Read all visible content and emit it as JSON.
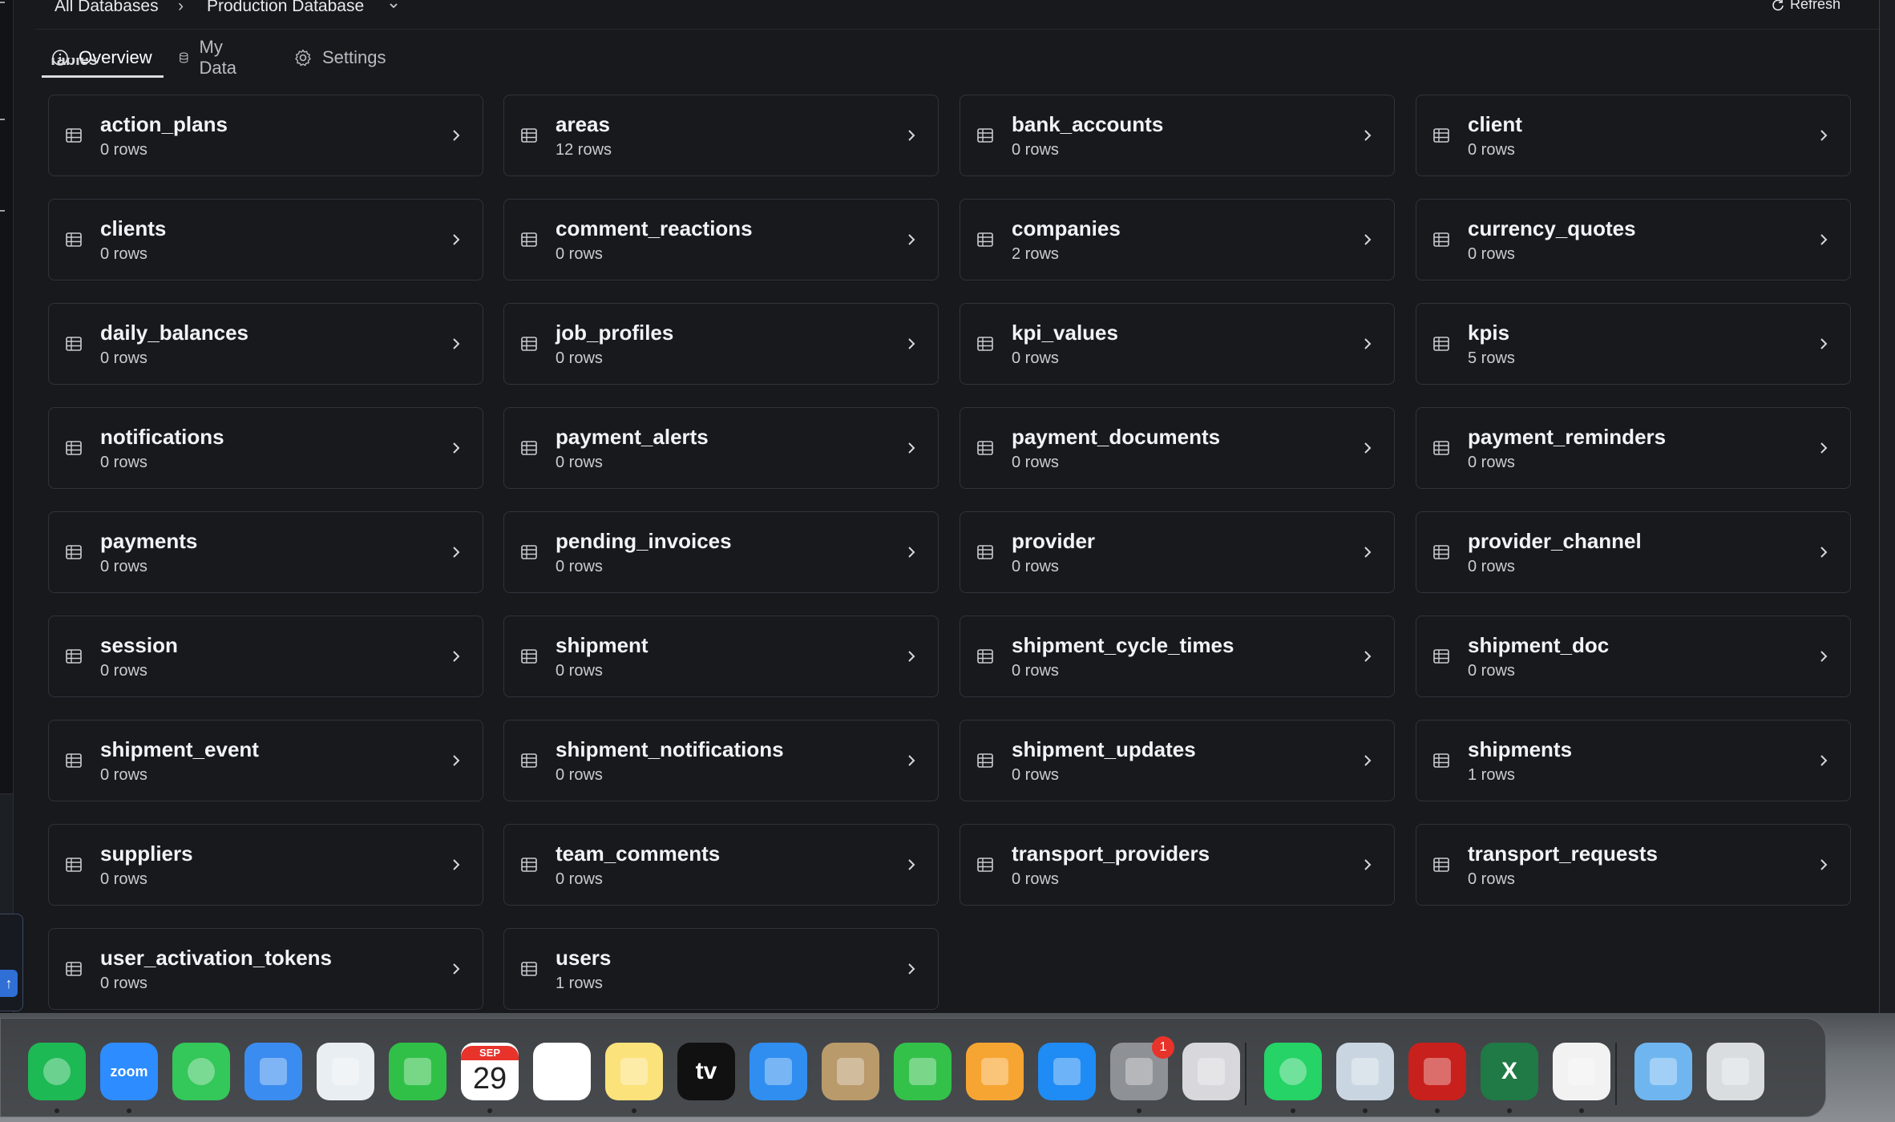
{
  "breadcrumb": {
    "root": "All Databases",
    "separator": "›",
    "current": "Production Database"
  },
  "header": {
    "refresh_label": "Refresh"
  },
  "tabs": [
    {
      "label": "Overview",
      "icon": "info-icon",
      "active": true
    },
    {
      "label": "My Data",
      "icon": "database-icon",
      "active": false
    },
    {
      "label": "Settings",
      "icon": "gear-icon",
      "active": false
    }
  ],
  "section": {
    "heading": "Tables"
  },
  "tables": [
    {
      "name": "action_plans",
      "rows": "0 rows"
    },
    {
      "name": "areas",
      "rows": "12 rows"
    },
    {
      "name": "bank_accounts",
      "rows": "0 rows"
    },
    {
      "name": "client",
      "rows": "0 rows"
    },
    {
      "name": "clients",
      "rows": "0 rows"
    },
    {
      "name": "comment_reactions",
      "rows": "0 rows"
    },
    {
      "name": "companies",
      "rows": "2 rows"
    },
    {
      "name": "currency_quotes",
      "rows": "0 rows"
    },
    {
      "name": "daily_balances",
      "rows": "0 rows"
    },
    {
      "name": "job_profiles",
      "rows": "0 rows"
    },
    {
      "name": "kpi_values",
      "rows": "0 rows"
    },
    {
      "name": "kpis",
      "rows": "5 rows"
    },
    {
      "name": "notifications",
      "rows": "0 rows"
    },
    {
      "name": "payment_alerts",
      "rows": "0 rows"
    },
    {
      "name": "payment_documents",
      "rows": "0 rows"
    },
    {
      "name": "payment_reminders",
      "rows": "0 rows"
    },
    {
      "name": "payments",
      "rows": "0 rows"
    },
    {
      "name": "pending_invoices",
      "rows": "0 rows"
    },
    {
      "name": "provider",
      "rows": "0 rows"
    },
    {
      "name": "provider_channel",
      "rows": "0 rows"
    },
    {
      "name": "session",
      "rows": "0 rows"
    },
    {
      "name": "shipment",
      "rows": "0 rows"
    },
    {
      "name": "shipment_cycle_times",
      "rows": "0 rows"
    },
    {
      "name": "shipment_doc",
      "rows": "0 rows"
    },
    {
      "name": "shipment_event",
      "rows": "0 rows"
    },
    {
      "name": "shipment_notifications",
      "rows": "0 rows"
    },
    {
      "name": "shipment_updates",
      "rows": "0 rows"
    },
    {
      "name": "shipments",
      "rows": "1 rows"
    },
    {
      "name": "suppliers",
      "rows": "0 rows"
    },
    {
      "name": "team_comments",
      "rows": "0 rows"
    },
    {
      "name": "transport_providers",
      "rows": "0 rows"
    },
    {
      "name": "transport_requests",
      "rows": "0 rows"
    },
    {
      "name": "user_activation_tokens",
      "rows": "0 rows"
    },
    {
      "name": "users",
      "rows": "1 rows"
    }
  ],
  "dock": {
    "apps": [
      {
        "name": "spotify",
        "label": "",
        "bg": "#1db954",
        "running": true
      },
      {
        "name": "zoom",
        "label": "zoom",
        "bg": "#2d8cff",
        "running": true
      },
      {
        "name": "messages",
        "label": "",
        "bg": "#34c759",
        "running": false
      },
      {
        "name": "mail",
        "label": "",
        "bg": "#3b8cf0",
        "running": false
      },
      {
        "name": "maps",
        "label": "",
        "bg": "#e8eef2",
        "running": false
      },
      {
        "name": "facetime",
        "label": "",
        "bg": "#30c048",
        "running": false
      },
      {
        "name": "calendar",
        "label": "29",
        "month": "SEP",
        "bg": "#ffffff",
        "running": true
      },
      {
        "name": "reminders",
        "label": "",
        "bg": "#ffffff",
        "running": false
      },
      {
        "name": "notes",
        "label": "",
        "bg": "#fbe27a",
        "running": true
      },
      {
        "name": "apple-tv",
        "label": "tv",
        "bg": "#111111",
        "running": false
      },
      {
        "name": "keynote",
        "label": "",
        "bg": "#2f8ef0",
        "running": false
      },
      {
        "name": "contacts",
        "label": "",
        "bg": "#b99a6b",
        "running": false
      },
      {
        "name": "numbers",
        "label": "",
        "bg": "#33c14a",
        "running": false
      },
      {
        "name": "pages",
        "label": "",
        "bg": "#f7a532",
        "running": false
      },
      {
        "name": "app-store",
        "label": "",
        "bg": "#1f8bf4",
        "running": false
      },
      {
        "name": "system-settings",
        "label": "",
        "bg": "#8e9196",
        "badge": "1",
        "running": true
      },
      {
        "name": "iphone-mirroring",
        "label": "",
        "bg": "#d8d8dc",
        "running": false
      },
      {
        "name": "whatsapp",
        "label": "",
        "bg": "#25d366",
        "running": true
      },
      {
        "name": "preview",
        "label": "",
        "bg": "#c9d6e2",
        "running": true
      },
      {
        "name": "acrobat",
        "label": "",
        "bg": "#c8201c",
        "running": true
      },
      {
        "name": "excel",
        "label": "X",
        "bg": "#1f7a45",
        "running": true
      },
      {
        "name": "microsoft-installer",
        "label": "",
        "bg": "#f2f2f2",
        "running": true
      },
      {
        "name": "downloads",
        "label": "",
        "bg": "#6fb6f0",
        "running": false
      },
      {
        "name": "trash",
        "label": "",
        "bg": "#d9dde0",
        "running": false
      }
    ]
  },
  "colors": {
    "background": "#17191d",
    "card_border": "#30333a",
    "text_primary": "#f2f3f5",
    "text_secondary": "#c9ccd1",
    "accent": "#2f6fd6"
  }
}
